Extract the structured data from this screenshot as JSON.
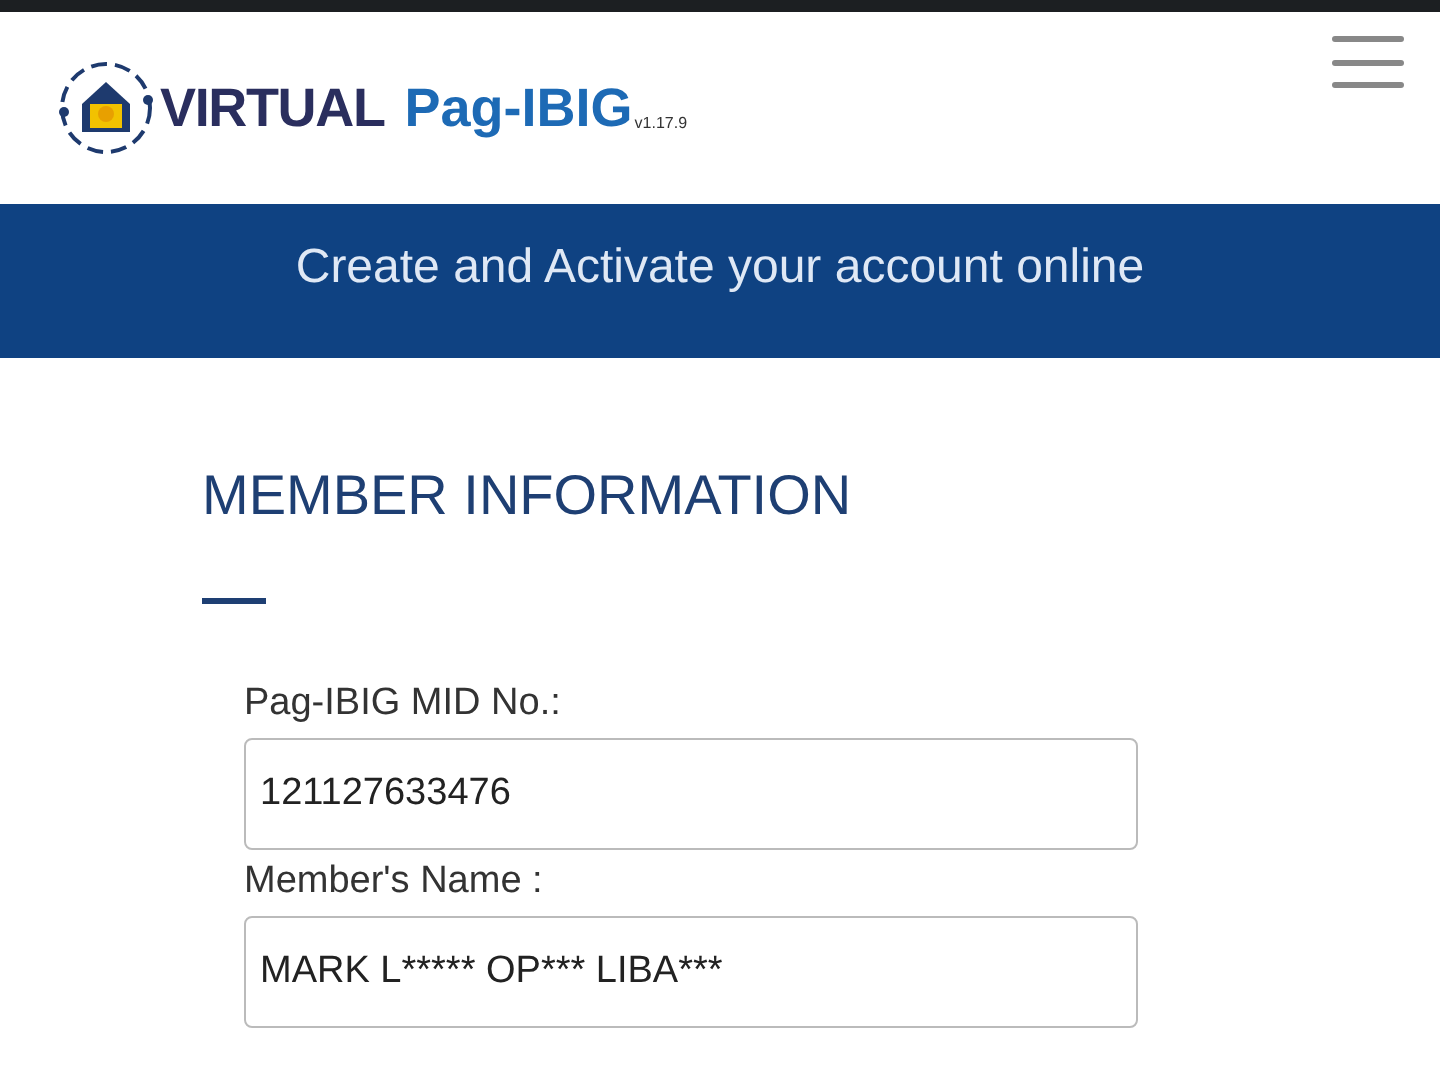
{
  "header": {
    "brand_first": "VIRTUAL",
    "brand_second": "Pag-IBIG",
    "version": "v1.17.9"
  },
  "banner": {
    "text": "Create and Activate your account online"
  },
  "section": {
    "title": "MEMBER INFORMATION"
  },
  "fields": [
    {
      "label": "Pag-IBIG MID No.:",
      "value": "121127633476"
    },
    {
      "label": "Member's Name :",
      "value": "MARK L***** OP*** LIBA***"
    }
  ]
}
